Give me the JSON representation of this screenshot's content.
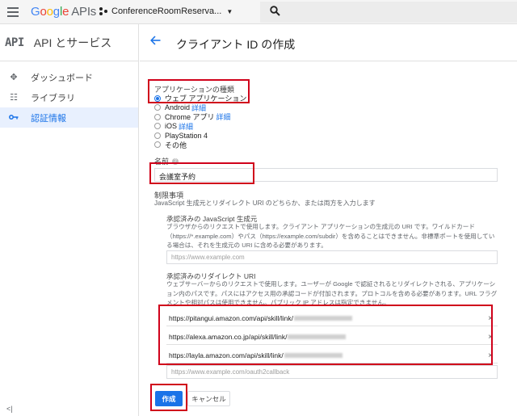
{
  "topbar": {
    "logo_letters": [
      "G",
      "o",
      "o",
      "g",
      "l",
      "e"
    ],
    "logo_suffix": "APIs",
    "project_name": "ConferenceRoomReserva...",
    "search_icon": "search-icon"
  },
  "sidebar": {
    "logo_text": "API",
    "title": "API とサービス",
    "items": [
      {
        "label": "ダッシュボード",
        "icon": "dashboard-icon"
      },
      {
        "label": "ライブラリ",
        "icon": "library-icon"
      },
      {
        "label": "認証情報",
        "icon": "key-icon",
        "active": true
      }
    ],
    "collapse_glyph": "<|"
  },
  "header": {
    "title": "クライアント ID の作成"
  },
  "form": {
    "app_type_label": "アプリケーションの種類",
    "app_types": [
      {
        "label": "ウェブ アプリケーション",
        "selected": true,
        "link": ""
      },
      {
        "label": "Android",
        "selected": false,
        "link": "詳細"
      },
      {
        "label": "Chrome アプリ",
        "selected": false,
        "link": "詳細"
      },
      {
        "label": "iOS",
        "selected": false,
        "link": "詳細"
      },
      {
        "label": "PlayStation 4",
        "selected": false,
        "link": ""
      },
      {
        "label": "その他",
        "selected": false,
        "link": ""
      }
    ],
    "name_label": "名前",
    "name_value": "会議室予約",
    "restrictions_title": "制限事項",
    "restrictions_desc": "JavaScript 生成元とリダイレクト URI のどちらか、または両方を入力します",
    "js_origins_title": "承認済みの JavaScript 生成元",
    "js_origins_desc": "ブラウザからのリクエストで使用します。クライアント アプリケーションの生成元の URI です。ワイルドカード（https://*.example.com）やパス（https://example.com/subdir）を含めることはできません。非標準ポートを使用している場合は、それを生成元の URI に含める必要があります。",
    "js_origins_placeholder": "https://www.example.com",
    "redirect_title": "承認済みのリダイレクト URI",
    "redirect_desc": "ウェブサーバーからのリクエストで使用します。ユーザーが Google で認証されるとリダイレクトされる、アプリケーション内のパスです。パスにはアクセス用の承認コードが付加されます。プロトコルを含める必要があります。URL フラグメントや相対パスは使用できません。パブリック IP アドレスは指定できません。",
    "redirect_uris": [
      "https://pitangui.amazon.com/api/skill/link/",
      "https://alexa.amazon.co.jp/api/skill/link/",
      "https://layla.amazon.com/api/skill/link/"
    ],
    "redirect_placeholder": "https://www.example.com/oauth2callback",
    "remove_glyph": "×",
    "create_label": "作成",
    "cancel_label": "キャンセル"
  },
  "colors": {
    "accent": "#1a73e8",
    "highlight": "#d0021b"
  }
}
